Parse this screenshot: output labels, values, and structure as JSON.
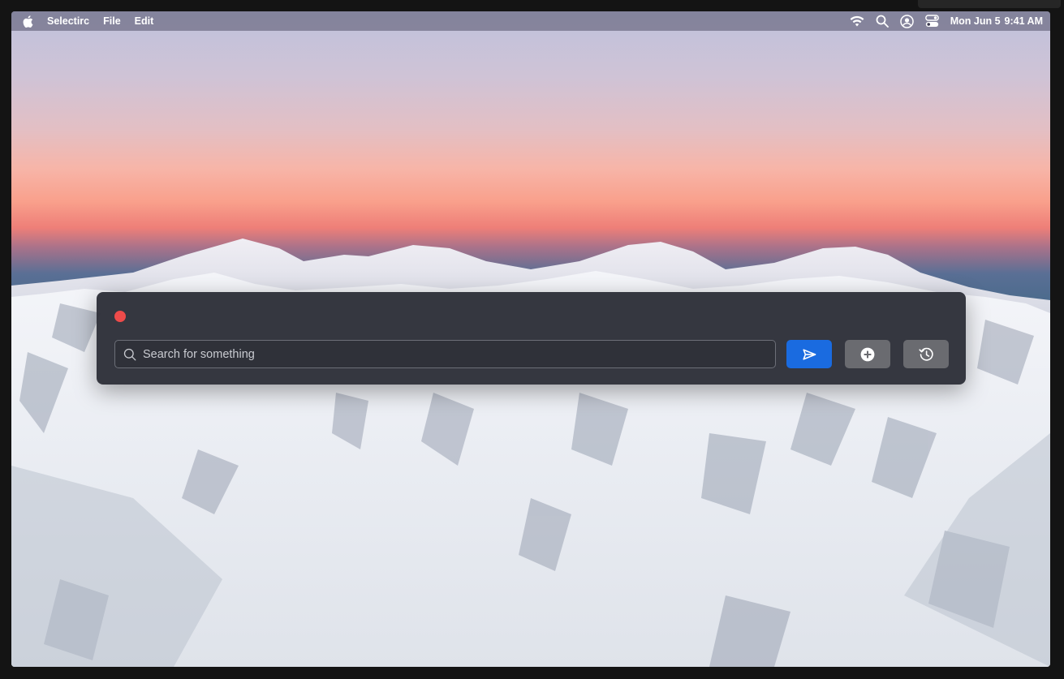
{
  "menubar": {
    "apple_icon": "apple-logo-icon",
    "app_name": "Selectirc",
    "menus": [
      "File",
      "Edit"
    ],
    "status_icons": [
      "wifi-icon",
      "search-icon",
      "user-icon",
      "control-center-icon"
    ],
    "date": "Mon Jun 5",
    "time": "9:41 AM"
  },
  "panel": {
    "close_button_color": "#ee4b4a",
    "search": {
      "placeholder": "Search for something",
      "value": "",
      "icon": "search-icon"
    },
    "buttons": [
      {
        "name": "send-button",
        "icon": "send-icon",
        "color": "#1a6be0"
      },
      {
        "name": "add-button",
        "icon": "plus-circle-icon",
        "color": "#6a6b70"
      },
      {
        "name": "history-button",
        "icon": "history-icon",
        "color": "#6a6b70"
      }
    ]
  }
}
